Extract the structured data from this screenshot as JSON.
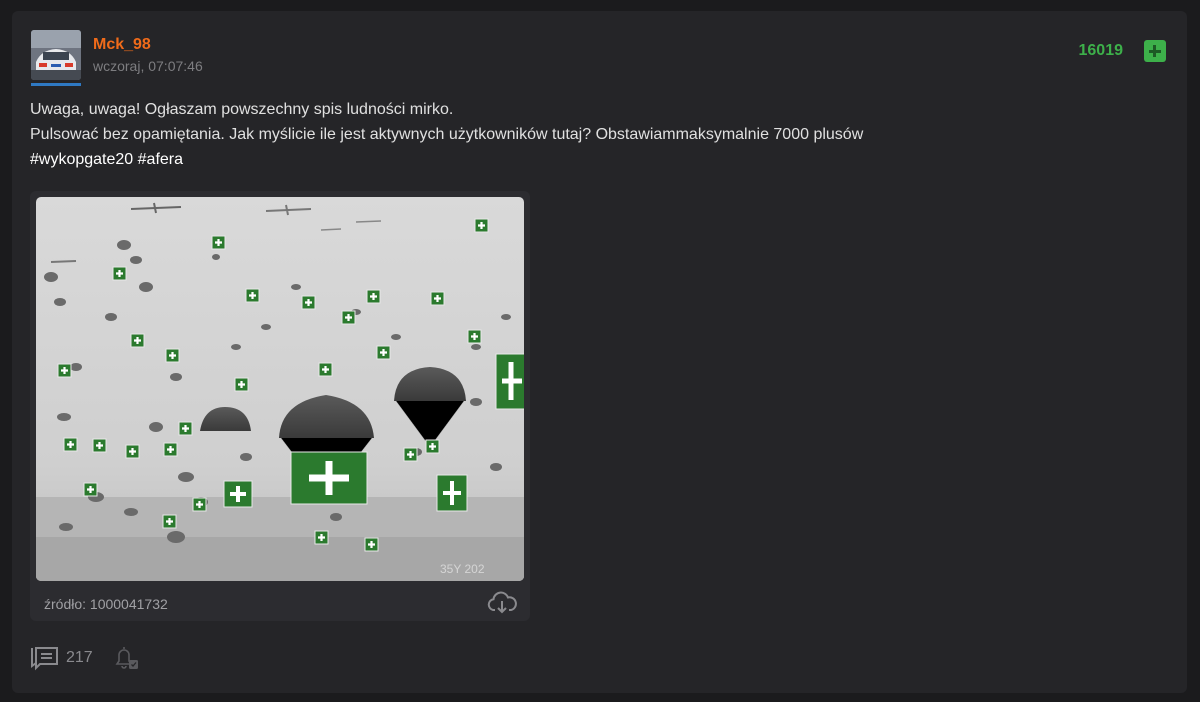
{
  "post": {
    "author": "Mck_98",
    "timestamp": "wczoraj, 07:07:46",
    "votes": "16019",
    "body": {
      "line1": "Uwaga, uwaga! Ogłaszam powszechny spis ludności mirko.",
      "line2": "Pulsować bez opamiętania. Jak myślicie ile jest aktywnych użytkowników tutaj? Obstawiammaksymalnie 7000 plusów",
      "tags": [
        "#wykopgate20",
        "#afera"
      ]
    },
    "embed": {
      "source": "źródło: 1000041732",
      "watermark": "35Y 202"
    },
    "footer": {
      "comments_count": "217"
    }
  },
  "icons": {
    "vote": "plus-icon",
    "download": "cloud-download-icon",
    "comments": "comments-icon",
    "notify": "bell-icon"
  },
  "colors": {
    "username": "#f06b1a",
    "votes": "#3db04a",
    "background": "#1b1b1d",
    "card": "#252528"
  }
}
